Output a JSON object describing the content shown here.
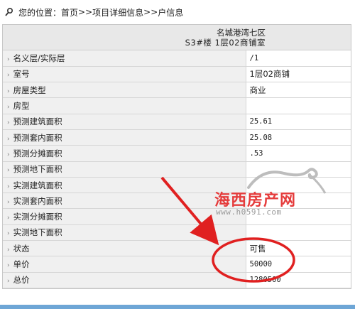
{
  "breadcrumb": {
    "prefix": "您的位置：",
    "home": "首页",
    "sep1": ">>",
    "project": "项目详细信息",
    "sep2": ">>",
    "current": "户信息"
  },
  "header": {
    "line1": "名城港湾七区",
    "line2": "S3#楼  1层02商铺室"
  },
  "rows": [
    {
      "label": "名义层/实际层",
      "value": "/1"
    },
    {
      "label": "室号",
      "value": "1层02商铺"
    },
    {
      "label": "房屋类型",
      "value": "商业"
    },
    {
      "label": "房型",
      "value": ""
    },
    {
      "label": "预测建筑面积",
      "value": "25.61"
    },
    {
      "label": "预测套内面积",
      "value": "25.08"
    },
    {
      "label": "预测分摊面积",
      "value": ".53"
    },
    {
      "label": "预测地下面积",
      "value": ""
    },
    {
      "label": "实测建筑面积",
      "value": ""
    },
    {
      "label": "实测套内面积",
      "value": ""
    },
    {
      "label": "实测分摊面积",
      "value": ""
    },
    {
      "label": "实测地下面积",
      "value": ""
    },
    {
      "label": "状态",
      "value": "可售"
    },
    {
      "label": "单价",
      "value": "50000"
    },
    {
      "label": "总价",
      "value": "1280500"
    }
  ],
  "row_marker": "›",
  "watermark": {
    "title": "海西房产网",
    "url": "www.h0591.com"
  },
  "colors": {
    "annotation_red": "#e02020",
    "header_bg": "#e8e8e8",
    "label_bg": "#f0f0f0",
    "bottom_bar": "#6ea6d6"
  },
  "icons": {
    "breadcrumb": "location-pin-icon"
  }
}
